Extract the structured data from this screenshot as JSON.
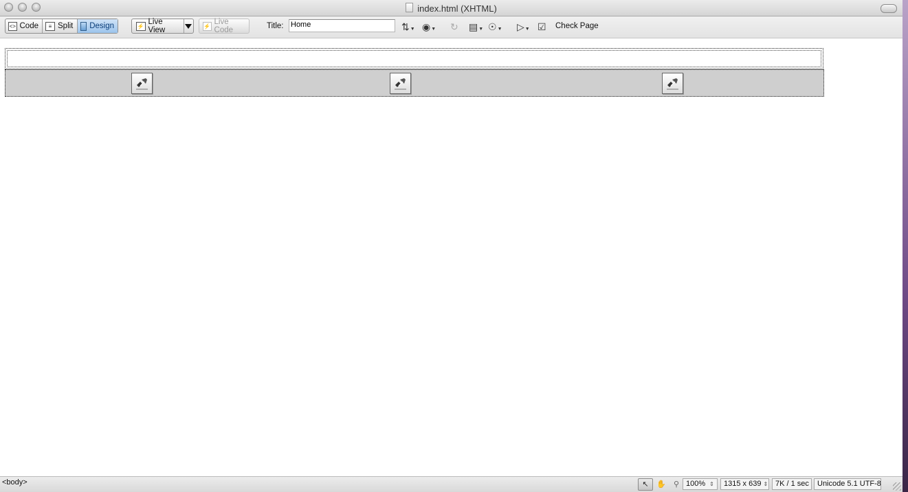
{
  "window": {
    "title": "index.html (XHTML)"
  },
  "toolbar": {
    "views": [
      {
        "label": "Code",
        "active": false
      },
      {
        "label": "Split",
        "active": false
      },
      {
        "label": "Design",
        "active": true
      }
    ],
    "live_view_label": "Live View",
    "live_code_label": "Live Code",
    "title_label": "Title:",
    "title_value": "Home",
    "check_page_label": "Check Page",
    "icons": [
      "file-management-icon",
      "preview-browser-icon",
      "refresh-icon",
      "visual-aids-icon",
      "view-options-icon",
      "validate-markup-icon",
      "check-page-icon"
    ]
  },
  "canvas": {
    "image_placeholders": 3
  },
  "status": {
    "tag_selector": "<body>",
    "zoom": "100%",
    "window_size": "1315 x 639",
    "download_stats": "7K / 1 sec",
    "encoding": "Unicode 5.1 UTF-8"
  },
  "colors": {
    "active_tab": "#9cc4ec",
    "nav_bar_bg": "#cfcfcf"
  }
}
